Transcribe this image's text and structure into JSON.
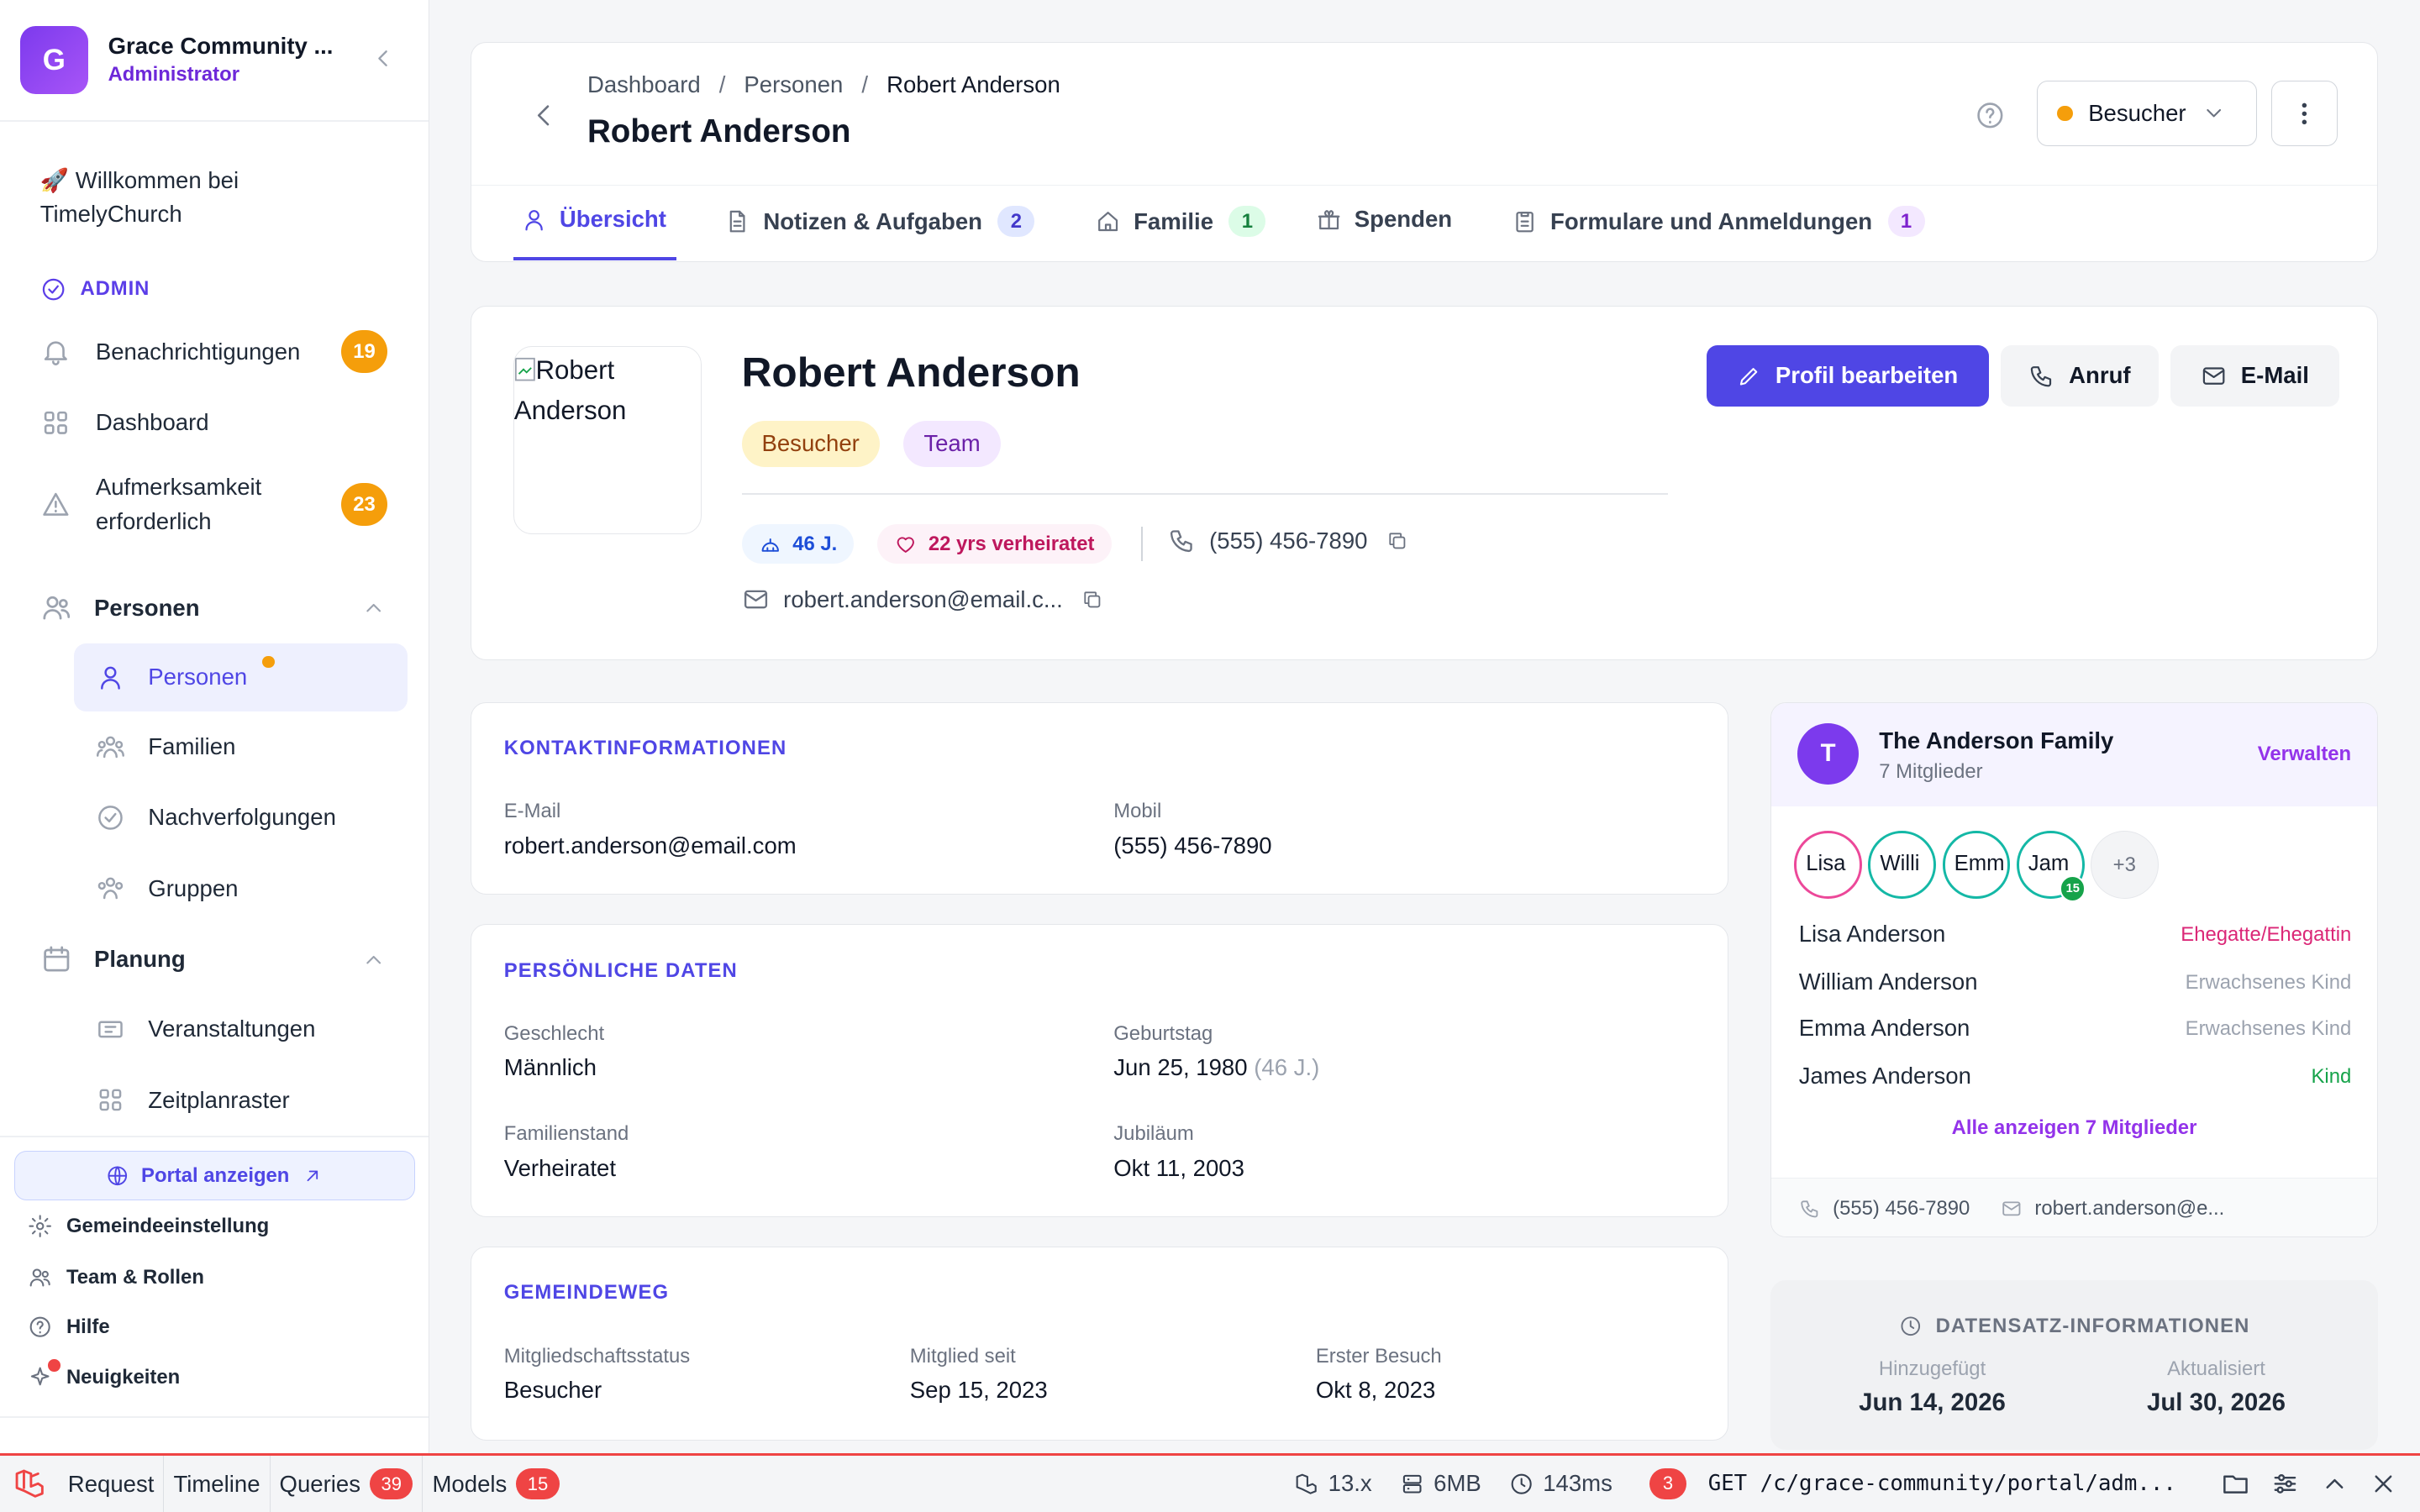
{
  "sidebar": {
    "org_initial": "G",
    "org_name": "Grace Community ...",
    "org_role": "Administrator",
    "welcome": "🚀 Willkommen bei TimelyChurch",
    "section_admin": "ADMIN",
    "notifications": {
      "label": "Benachrichtigungen",
      "count": "19"
    },
    "dashboard": "Dashboard",
    "attention": {
      "label": "Aufmerksamkeit erforderlich",
      "count": "23"
    },
    "people_group": "Personen",
    "people_items": [
      "Personen",
      "Familien",
      "Nachverfolgungen",
      "Gruppen"
    ],
    "planning_group": "Planung",
    "planning_items": [
      "Veranstaltungen",
      "Zeitplanraster"
    ],
    "portal_button": "Portal anzeigen",
    "links": [
      "Gemeindeeinstellung",
      "Team & Rollen",
      "Hilfe",
      "Neuigkeiten"
    ]
  },
  "header": {
    "breadcrumb": [
      "Dashboard",
      "Personen",
      "Robert Anderson"
    ],
    "title": "Robert Anderson",
    "status": "Besucher",
    "status_color": "#f59e0b",
    "tabs": [
      {
        "label": "Übersicht",
        "count": ""
      },
      {
        "label": "Notizen & Aufgaben",
        "count": "2"
      },
      {
        "label": "Familie",
        "count": "1"
      },
      {
        "label": "Spenden",
        "count": ""
      },
      {
        "label": "Formulare und Anmeldungen",
        "count": "1"
      }
    ]
  },
  "profile": {
    "avatar_alt": "Robert Anderson",
    "name": "Robert Anderson",
    "tags": [
      "Besucher",
      "Team"
    ],
    "age": "46 J.",
    "married": "22 yrs verheiratet",
    "phone": "(555) 456-7890",
    "email": "robert.anderson@email.c...",
    "edit_button": "Profil bearbeiten",
    "call_button": "Anruf",
    "email_button": "E-Mail",
    "accent_color": "#4f46e5"
  },
  "contact": {
    "title": "KONTAKTINFORMATIONEN",
    "email_label": "E-Mail",
    "email": "robert.anderson@email.com",
    "mobile_label": "Mobil",
    "mobile": "(555) 456-7890"
  },
  "personal": {
    "title": "PERSÖNLICHE DATEN",
    "gender_label": "Geschlecht",
    "gender": "Männlich",
    "birthday_label": "Geburtstag",
    "birthday": "Jun 25, 1980",
    "birthday_age": "(46 J.)",
    "marital_label": "Familienstand",
    "marital": "Verheiratet",
    "anniversary_label": "Jubiläum",
    "anniversary": "Okt 11, 2003"
  },
  "journey": {
    "title": "GEMEINDEWEG",
    "status_label": "Mitgliedschaftsstatus",
    "status": "Besucher",
    "member_since_label": "Mitglied seit",
    "member_since": "Sep 15, 2023",
    "first_visit_label": "Erster Besuch",
    "first_visit": "Okt 8, 2023"
  },
  "family": {
    "initial": "T",
    "name": "The Anderson Family",
    "count": "7 Mitglieder",
    "manage": "Verwalten",
    "avatars": [
      "Lisa",
      "Willi",
      "Emm",
      "Jam"
    ],
    "avatar_badge": "15",
    "more": "+3",
    "members": [
      {
        "name": "Lisa Anderson",
        "role": "Ehegatte/Ehegattin",
        "role_color": "#db2777"
      },
      {
        "name": "William Anderson",
        "role": "Erwachsenes Kind",
        "role_color": "#9ca3af"
      },
      {
        "name": "Emma Anderson",
        "role": "Erwachsenes Kind",
        "role_color": "#9ca3af"
      },
      {
        "name": "James Anderson",
        "role": "Kind",
        "role_color": "#16a34a"
      }
    ],
    "show_all": "Alle anzeigen 7 Mitglieder",
    "phone": "(555) 456-7890",
    "email": "robert.anderson@e..."
  },
  "record": {
    "title": "DATENSATZ-INFORMATIONEN",
    "added_label": "Hinzugefügt",
    "added": "Jun 14, 2026",
    "updated_label": "Aktualisiert",
    "updated": "Jul 30, 2026"
  },
  "debugbar": {
    "tabs": [
      {
        "label": "Request",
        "count": ""
      },
      {
        "label": "Timeline",
        "count": ""
      },
      {
        "label": "Queries",
        "count": "39"
      },
      {
        "label": "Models",
        "count": "15"
      }
    ],
    "version": "13.x",
    "memory": "6MB",
    "time": "143ms",
    "request_count": "3",
    "request": "GET /c/grace-community/portal/adm..."
  }
}
